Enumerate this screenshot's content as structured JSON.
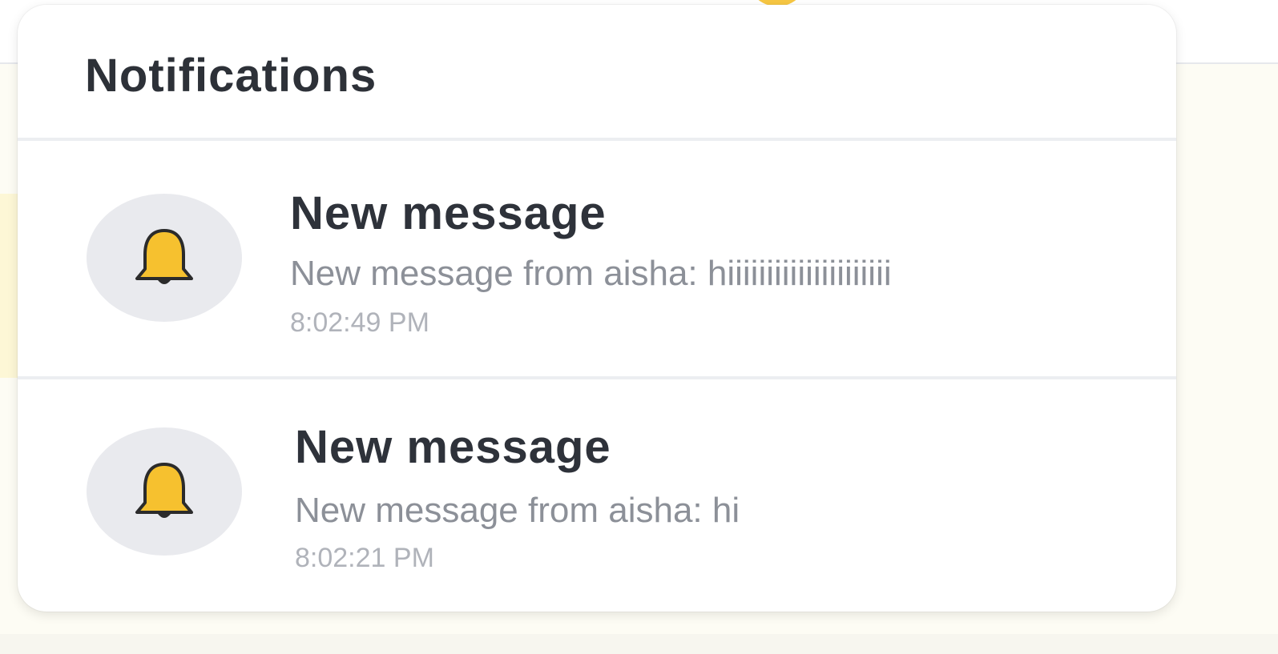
{
  "panel": {
    "title": "Notifications"
  },
  "notifications": [
    {
      "icon": "bell-icon",
      "title": "New message",
      "body": "New message from aisha: hiiiiiiiiiiiiiiiiiiiii",
      "time": "8:02:49 PM"
    },
    {
      "icon": "bell-icon",
      "title": "New message",
      "body": "New message from aisha: hi",
      "time": "8:02:21 PM"
    }
  ],
  "colors": {
    "bell": "#f6c12f",
    "icon_bg": "#e9eaee",
    "title_text": "#2e323a",
    "body_text": "#8c9098",
    "time_text": "#b0b3ba"
  }
}
